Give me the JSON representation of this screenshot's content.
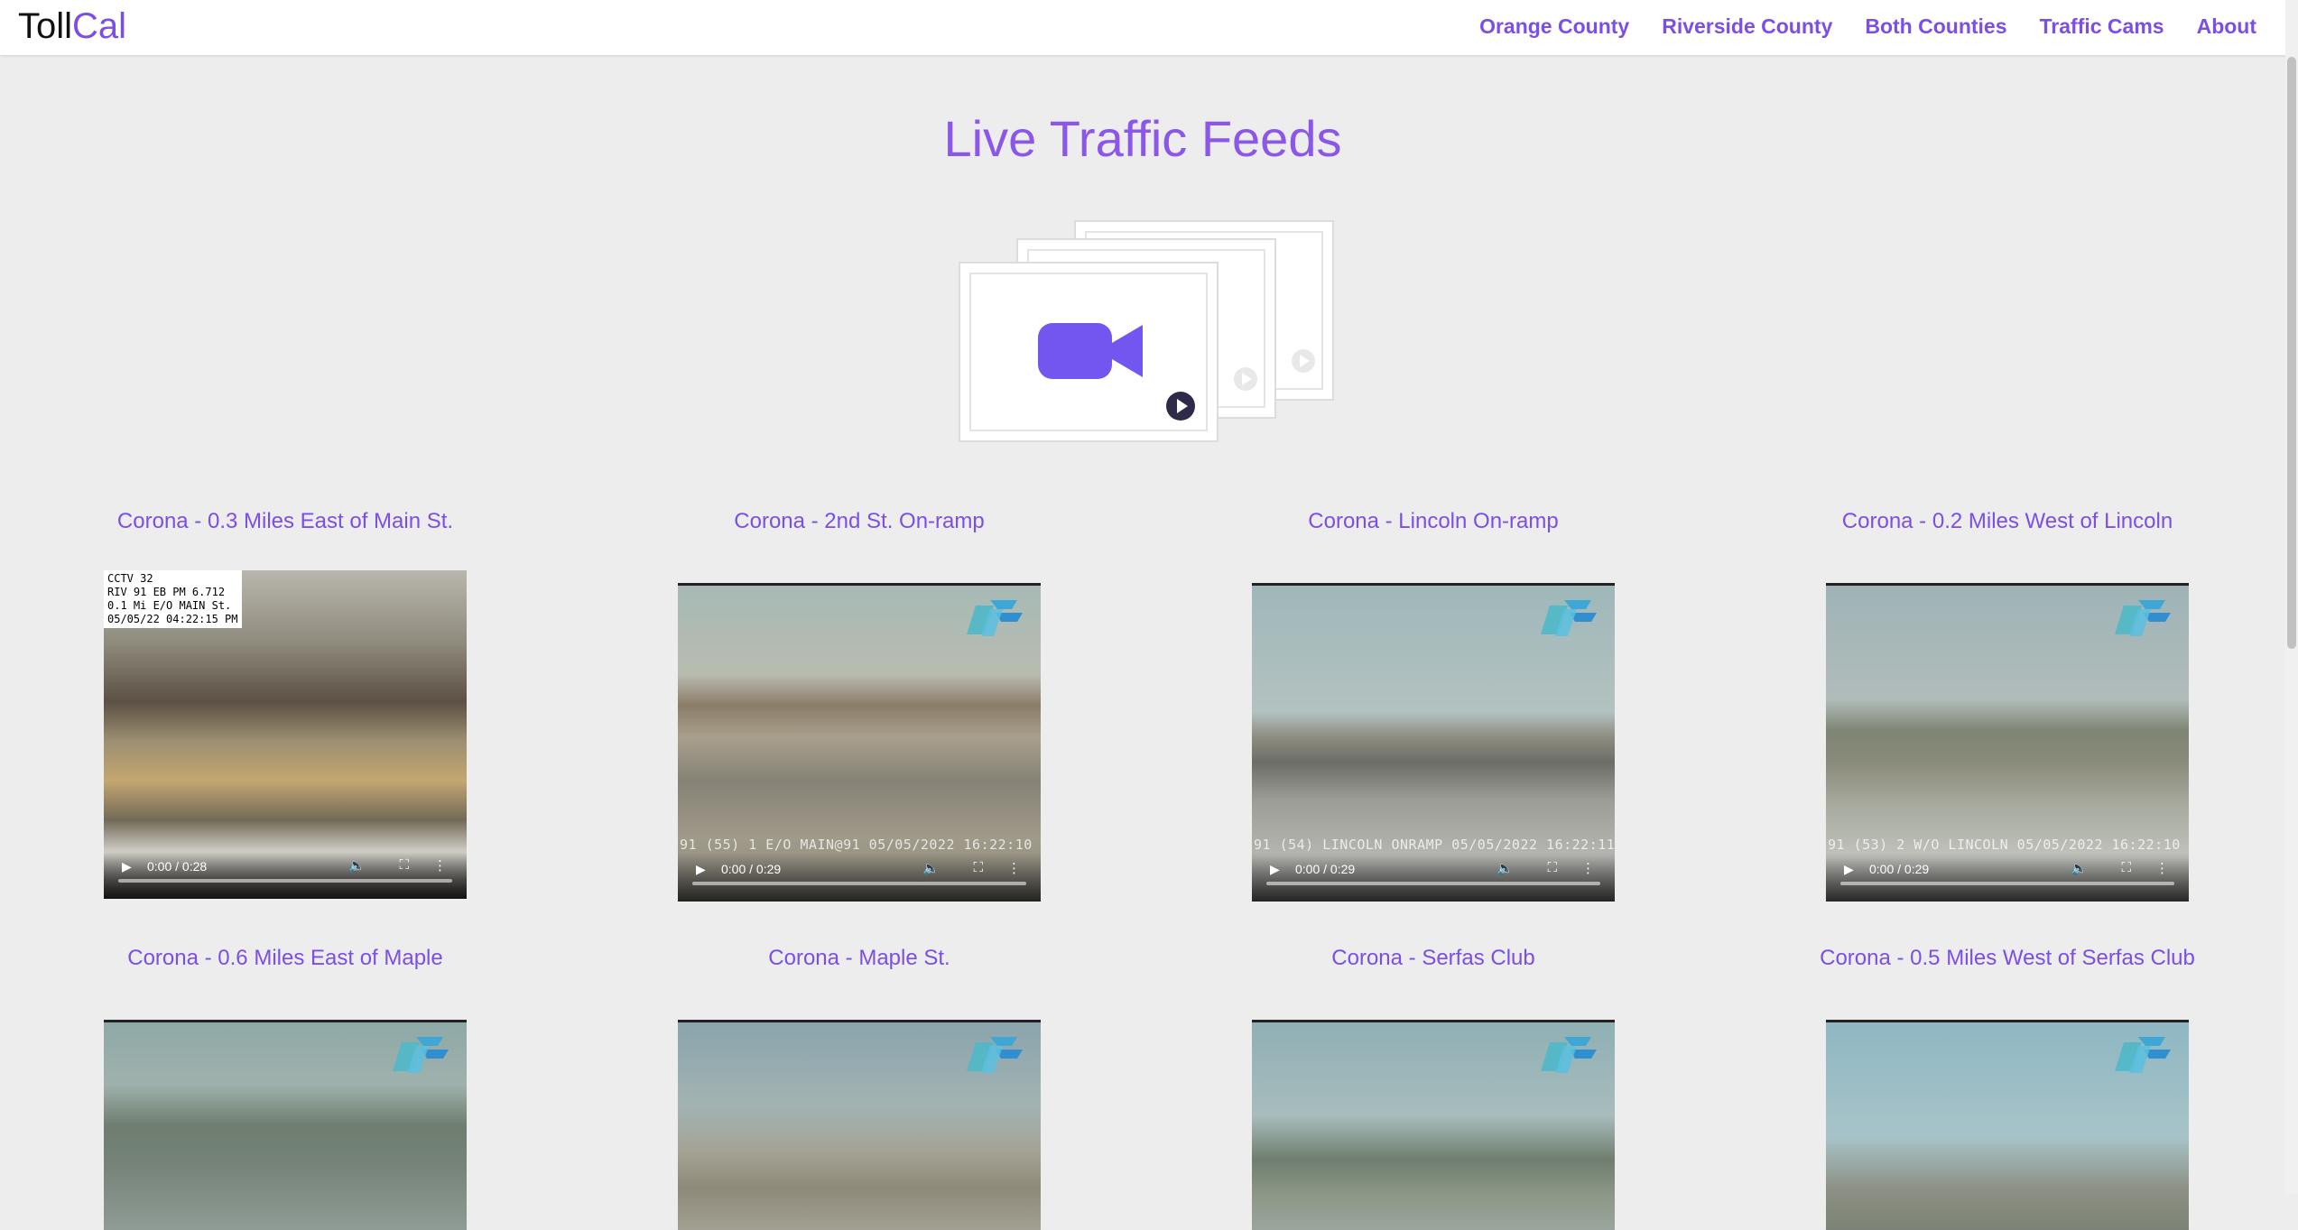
{
  "brand": {
    "part1": "Toll",
    "part2": "Cal"
  },
  "nav": {
    "items": [
      {
        "label": "Orange County"
      },
      {
        "label": "Riverside County"
      },
      {
        "label": "Both Counties"
      },
      {
        "label": "Traffic Cams"
      },
      {
        "label": "About"
      }
    ]
  },
  "page": {
    "title": "Live Traffic Feeds"
  },
  "cams": [
    {
      "title": "Corona - 0.3 Miles East of Main St.",
      "time": "0:00 / 0:28",
      "info": "CCTV 32\nRIV 91 EB PM 6.712\n0.1 Mi E/O MAIN St.\n05/05/22 04:22:15 PM"
    },
    {
      "title": "Corona - 2nd St. On-ramp",
      "time": "0:00 / 0:29",
      "stamp": "91 (55) 1 E/O MAIN@91 05/05/2022 16:22:10"
    },
    {
      "title": "Corona - Lincoln On-ramp",
      "time": "0:00 / 0:29",
      "stamp": "91 (54) LINCOLN ONRAMP 05/05/2022 16:22:11"
    },
    {
      "title": "Corona - 0.2 Miles West of Lincoln",
      "time": "0:00 / 0:29",
      "stamp": "91 (53) 2 W/O LINCOLN 05/05/2022 16:22:10"
    },
    {
      "title": "Corona - 0.6 Miles East of Maple"
    },
    {
      "title": "Corona - Maple St."
    },
    {
      "title": "Corona - Serfas Club"
    },
    {
      "title": "Corona - 0.5 Miles West of Serfas Club"
    }
  ],
  "colors": {
    "accent": "#7b4fe6",
    "title": "#8a57e8",
    "background": "#ededed"
  }
}
